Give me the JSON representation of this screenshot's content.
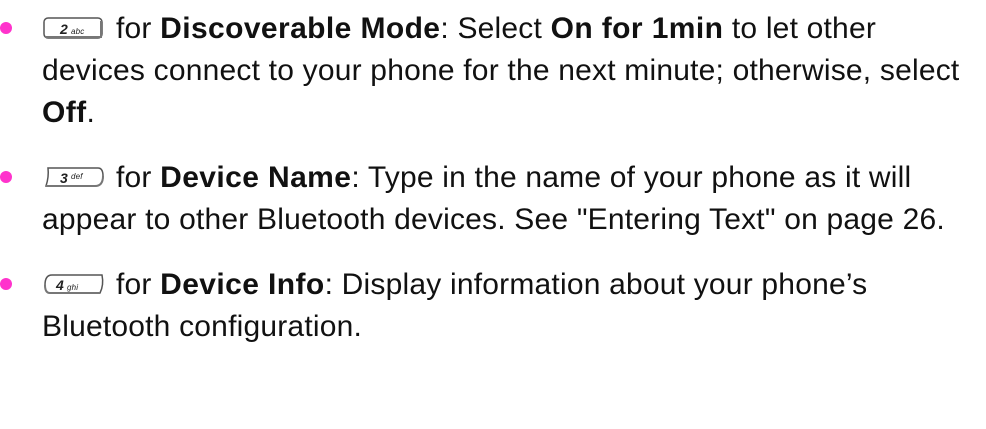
{
  "colors": {
    "bullet": "#ff33cc",
    "text": "#111111"
  },
  "items": [
    {
      "key_icon": "2abc-key-icon",
      "key_digit": "2",
      "key_letters": "abc",
      "prefix": "for ",
      "term": "Discoverable Mode",
      "text_before": ": Select ",
      "option": "On for 1min",
      "text_after": " to let other devices connect to your phone for the next minute; otherwise, select ",
      "option2": "Off",
      "end": "."
    },
    {
      "key_icon": "3def-key-icon",
      "key_digit": "3",
      "key_letters": "def",
      "prefix": "for ",
      "term": "Device Name",
      "text_after": ": Type in the name of your phone as it will appear to other Bluetooth devices. See \"Entering Text\" on page 26."
    },
    {
      "key_icon": "4ghi-key-icon",
      "key_digit": "4",
      "key_letters": "ghi",
      "prefix": "for ",
      "term": "Device Info",
      "text_after": ": Display information about your phone’s Bluetooth configuration."
    }
  ]
}
